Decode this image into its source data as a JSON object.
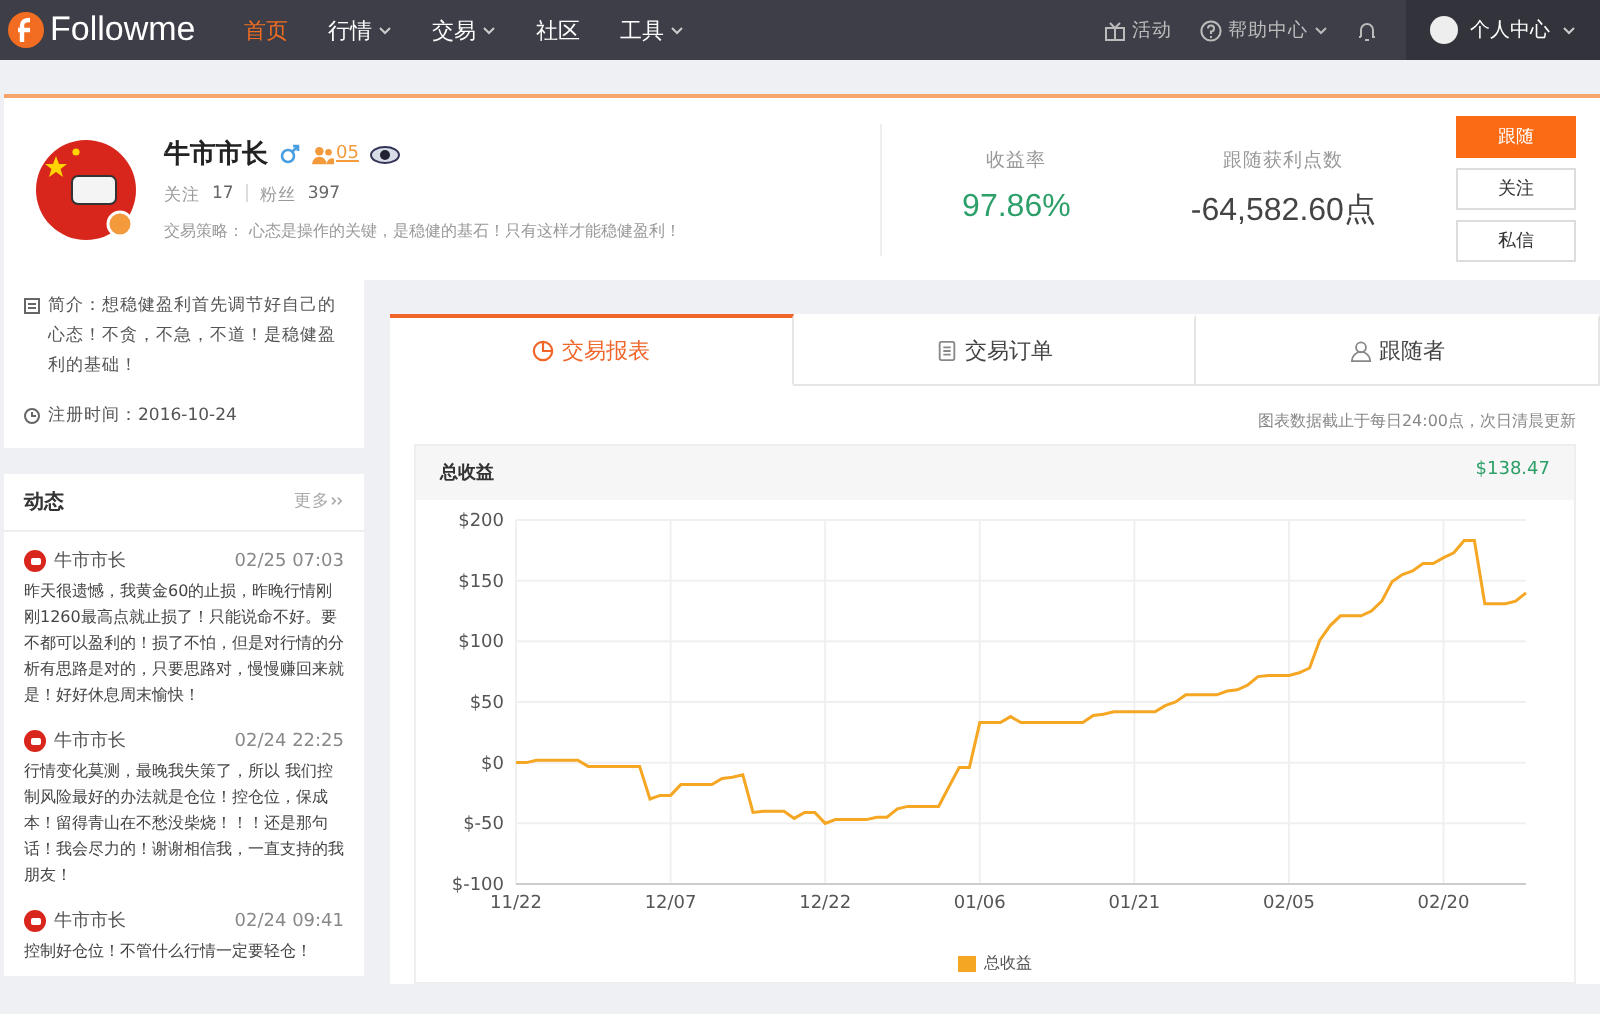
{
  "nav": {
    "logo": "Followme",
    "items": [
      {
        "label": "首页",
        "selected": true,
        "dropdown": false
      },
      {
        "label": "行情",
        "selected": false,
        "dropdown": true
      },
      {
        "label": "交易",
        "selected": false,
        "dropdown": true
      },
      {
        "label": "社区",
        "selected": false,
        "dropdown": false
      },
      {
        "label": "工具",
        "selected": false,
        "dropdown": true
      }
    ],
    "activity": "活动",
    "help": "帮助中心",
    "user": "个人中心"
  },
  "profile": {
    "name": "牛市市长",
    "male": true,
    "followers_badge": "05",
    "following_label": "关注",
    "following": "17",
    "fans_label": "粉丝",
    "fans": "397",
    "strategy_label": "交易策略：",
    "strategy": "心态是操作的关键，是稳健的基石！只有这样才能稳健盈利！",
    "stats": [
      {
        "label": "收益率",
        "value": "97.86%",
        "kind": "positive"
      },
      {
        "label": "跟随获利点数",
        "value": "-64,582.60点",
        "kind": "neutral"
      }
    ],
    "buttons": [
      {
        "label": "跟随",
        "primary": true
      },
      {
        "label": "关注",
        "primary": false
      },
      {
        "label": "私信",
        "primary": false
      }
    ]
  },
  "intro": {
    "text": "简介：想稳健盈利首先调节好自己的心态！不贪，不急，不道！是稳健盈利的基础！",
    "registered": "注册时间：2016-10-24"
  },
  "feed": {
    "title": "动态",
    "more": "更多",
    "items": [
      {
        "author": "牛市市长",
        "time": "02/25 07:03",
        "text": "昨天很遗憾，我黄金60的止损，昨晚行情刚刚1260最高点就止损了！只能说命不好。要不都可以盈利的！损了不怕，但是对行情的分析有思路是对的，只要思路对，慢慢赚回来就是！好好休息周末愉快！"
      },
      {
        "author": "牛市市长",
        "time": "02/24 22:25",
        "text": "行情变化莫测，最晚我失策了，所以 我们控制风险最好的办法就是仓位！控仓位，保成本！留得青山在不愁没柴烧！！！还是那句话！我会尽力的！谢谢相信我，一直支持的我朋友！"
      },
      {
        "author": "牛市市长",
        "time": "02/24 09:41",
        "text": "控制好仓位！不管什么行情一定要轻仓！"
      }
    ]
  },
  "tabs": [
    {
      "label": "交易报表",
      "selected": true,
      "kind": "report"
    },
    {
      "label": "交易订单",
      "selected": false,
      "kind": "orders"
    },
    {
      "label": "跟随者",
      "selected": false,
      "kind": "followers"
    }
  ],
  "chart_note": "图表数据截止于每日24:00点，次日清晨更新",
  "chart_panel": {
    "title": "总收益",
    "total": "$138.47",
    "chart_data": {
      "type": "line",
      "categories": [
        "11/22",
        null,
        null,
        null,
        null,
        null,
        null,
        null,
        null,
        null,
        null,
        null,
        null,
        null,
        null,
        "12/07",
        null,
        null,
        null,
        null,
        null,
        null,
        null,
        null,
        null,
        null,
        null,
        null,
        null,
        null,
        "12/22",
        null,
        null,
        null,
        null,
        null,
        null,
        null,
        null,
        null,
        null,
        null,
        null,
        null,
        null,
        "01/06",
        null,
        null,
        null,
        null,
        null,
        null,
        null,
        null,
        null,
        null,
        null,
        null,
        null,
        null,
        "01/21",
        null,
        null,
        null,
        null,
        null,
        null,
        null,
        null,
        null,
        null,
        null,
        null,
        null,
        null,
        "02/05",
        null,
        null,
        null,
        null,
        null,
        null,
        null,
        null,
        null,
        null,
        null,
        null,
        null,
        null,
        "02/20",
        null,
        null,
        null,
        null,
        null,
        null,
        null,
        null
      ],
      "series": [
        {
          "name": "总收益",
          "color": "#f5a623",
          "values": [
            0,
            0,
            2,
            2,
            2,
            2,
            2,
            -3,
            -3,
            -3,
            -3,
            -3,
            -3,
            -30,
            -27,
            -27,
            -18,
            -18,
            -18,
            -18,
            -13,
            -12,
            -10,
            -41,
            -40,
            -40,
            -40,
            -46,
            -41,
            -41,
            -50,
            -47,
            -47,
            -47,
            -47,
            -45,
            -45,
            -38,
            -36,
            -36,
            -36,
            -36,
            -20,
            -4,
            -4,
            33,
            33,
            33,
            38,
            33,
            33,
            33,
            33,
            33,
            33,
            33,
            39,
            40,
            42,
            42,
            42,
            42,
            42,
            47,
            50,
            56,
            56,
            56,
            56,
            59,
            60,
            64,
            71,
            72,
            72,
            72,
            74,
            78,
            101,
            113,
            121,
            121,
            121,
            125,
            133,
            149,
            155,
            158,
            164,
            164,
            169,
            173,
            183,
            183,
            131,
            131,
            131,
            133,
            140
          ]
        }
      ],
      "ylim": [
        -100,
        200
      ],
      "grid": true,
      "yticks": [
        {
          "value": -100,
          "label": "$-100"
        },
        {
          "value": -50,
          "label": "$-50"
        },
        {
          "value": 0,
          "label": "$0"
        },
        {
          "value": 50,
          "label": "$50"
        },
        {
          "value": 100,
          "label": "$100"
        },
        {
          "value": 150,
          "label": "$150"
        },
        {
          "value": 200,
          "label": "$200"
        }
      ]
    }
  }
}
